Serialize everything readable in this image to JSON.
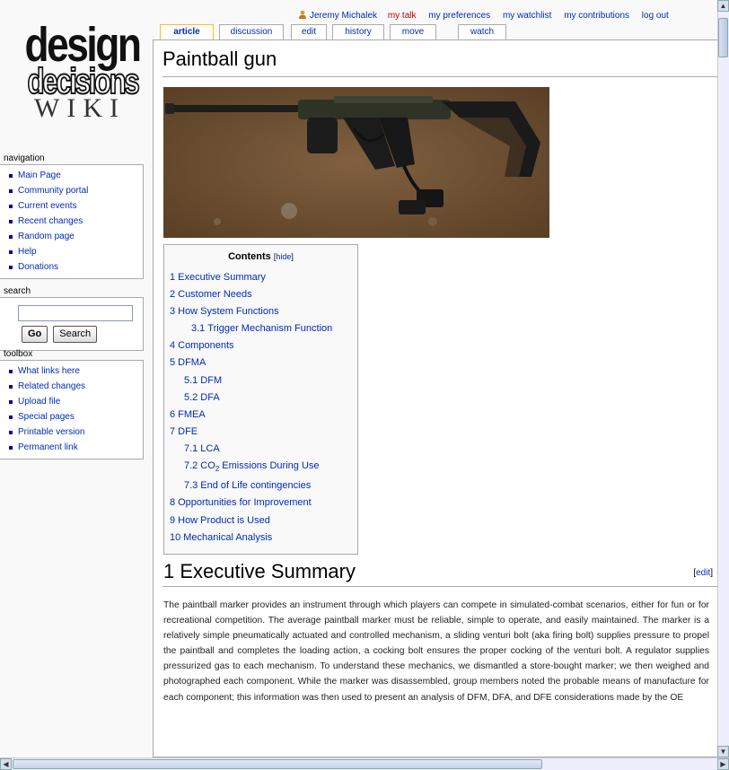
{
  "logo": {
    "line1": "design",
    "line2": "decisions",
    "line3": "WIKI"
  },
  "personal": {
    "user": "Jeremy Michalek",
    "mytalk": "my talk",
    "preferences": "my preferences",
    "watchlist": "my watchlist",
    "contributions": "my contributions",
    "logout": "log out",
    "user_icon": "user-icon"
  },
  "tabs": [
    "article",
    "discussion",
    "edit",
    "history",
    "move",
    "watch"
  ],
  "navigation": {
    "title": "navigation",
    "items": [
      "Main Page",
      "Community portal",
      "Current events",
      "Recent changes",
      "Random page",
      "Help",
      "Donations"
    ]
  },
  "search": {
    "title": "search",
    "input_value": "",
    "go": "Go",
    "search": "Search"
  },
  "toolbox": {
    "title": "toolbox",
    "items": [
      "What links here",
      "Related changes",
      "Upload file",
      "Special pages",
      "Printable version",
      "Permanent link"
    ]
  },
  "page": {
    "title": "Paintball gun",
    "image_alt": "paintball-gun-photo"
  },
  "toc": {
    "title": "Contents",
    "hide": "hide",
    "items": [
      {
        "num": "1",
        "text": "Executive Summary"
      },
      {
        "num": "2",
        "text": "Customer Needs"
      },
      {
        "num": "3",
        "text": "How System Functions"
      },
      {
        "num": "3.1",
        "text": "Trigger Mechanism Function"
      },
      {
        "num": "4",
        "text": "Components"
      },
      {
        "num": "5",
        "text": "DFMA"
      },
      {
        "num": "5.1",
        "text": "DFM"
      },
      {
        "num": "5.2",
        "text": "DFA"
      },
      {
        "num": "6",
        "text": "FMEA"
      },
      {
        "num": "7",
        "text": "DFE"
      },
      {
        "num": "7.1",
        "text": "LCA"
      },
      {
        "num": "7.2",
        "text": "CO2 Emissions During Use"
      },
      {
        "num": "7.3",
        "text": "End of Life contingencies"
      },
      {
        "num": "8",
        "text": "Opportunities for Improvement"
      },
      {
        "num": "9",
        "text": "How Product is Used"
      },
      {
        "num": "10",
        "text": "Mechanical Analysis"
      }
    ]
  },
  "section1": {
    "heading": "1 Executive Summary",
    "edit": "edit",
    "text": "The paintball marker provides an instrument through which players can compete in simulated-combat scenarios, either for fun or for recreational competition. The average paintball marker must be reliable, simple to operate, and easily maintained. The marker is a relatively simple pneumatically actuated and controlled mechanism, a sliding venturi bolt (aka firing bolt) supplies pressure to propel the paintball and completes the loading action, a cocking bolt ensures the proper cocking of the venturi bolt. A regulator supplies pressurized gas to each mechanism. To understand these mechanics, we dismantled a store-bought marker; we then weighed and photographed each component. While the marker was disassembled, group members noted the probable means of manufacture for each component; this information was then used to present an analysis of DFM, DFA, and DFE considerations made by the OE"
  }
}
